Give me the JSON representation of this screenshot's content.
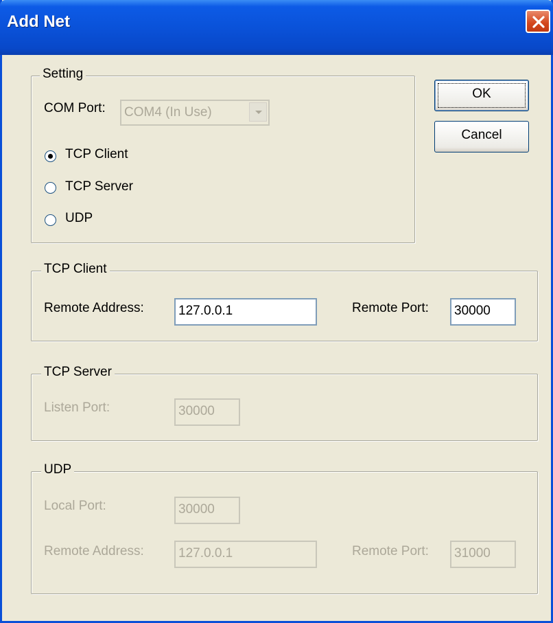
{
  "window": {
    "title": "Add Net"
  },
  "buttons": {
    "ok": "OK",
    "cancel": "Cancel"
  },
  "setting": {
    "title": "Setting",
    "com_port_label": "COM Port:",
    "com_port_value": "COM4 (In Use)",
    "modes": [
      {
        "label": "TCP Client",
        "checked": true
      },
      {
        "label": "TCP Server",
        "checked": false
      },
      {
        "label": "UDP",
        "checked": false
      }
    ]
  },
  "tcp_client": {
    "title": "TCP Client",
    "remote_address_label": "Remote Address:",
    "remote_address_value": "127.0.0.1",
    "remote_port_label": "Remote Port:",
    "remote_port_value": "30000"
  },
  "tcp_server": {
    "title": "TCP Server",
    "listen_port_label": "Listen Port:",
    "listen_port_value": "30000"
  },
  "udp": {
    "title": "UDP",
    "local_port_label": "Local Port:",
    "local_port_value": "30000",
    "remote_address_label": "Remote Address:",
    "remote_address_value": "127.0.0.1",
    "remote_port_label": "Remote Port:",
    "remote_port_value": "31000"
  },
  "colors": {
    "titlebar": "#0a52d9",
    "dialog_bg": "#ece9d8",
    "disabled_text": "#aca899",
    "close_button": "#d3461c"
  }
}
